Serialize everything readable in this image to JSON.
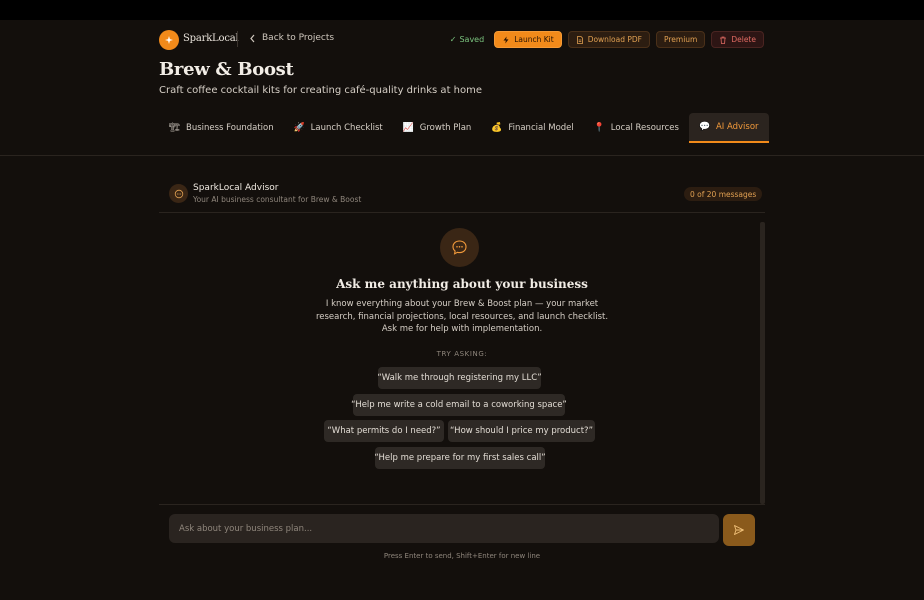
{
  "header": {
    "brand": "SparkLocal",
    "back_label": "Back to Projects",
    "saved_label": "Saved",
    "launch_kit_label": "Launch Kit",
    "download_pdf_label": "Download PDF",
    "premium_label": "Premium",
    "delete_label": "Delete"
  },
  "project": {
    "title": "Brew & Boost",
    "subtitle": "Craft coffee cocktail kits for creating café-quality drinks at home"
  },
  "tabs": [
    {
      "label": "Business Foundation",
      "icon": "🏗"
    },
    {
      "label": "Launch Checklist",
      "icon": "🚀"
    },
    {
      "label": "Growth Plan",
      "icon": "📈"
    },
    {
      "label": "Financial Model",
      "icon": "💰"
    },
    {
      "label": "Local Resources",
      "icon": "📍"
    },
    {
      "label": "AI Advisor",
      "icon": "💬"
    }
  ],
  "advisor": {
    "name": "SparkLocal Advisor",
    "subtitle": "Your AI business consultant for Brew & Boost",
    "message_count": "0 of 20 messages"
  },
  "empty_state": {
    "title": "Ask me anything about your business",
    "description": "I know everything about your Brew & Boost plan — your market research, financial projections, local resources, and launch checklist. Ask me for help with implementation.",
    "try_label": "TRY ASKING:"
  },
  "suggestions": [
    "“Walk me through registering my LLC”",
    "“Help me write a cold email to a coworking space”",
    "“What permits do I need?”",
    "“How should I price my product?”",
    "“Help me prepare for my first sales call”"
  ],
  "composer": {
    "placeholder": "Ask about your business plan...",
    "hint": "Press Enter to send, Shift+Enter for new line"
  },
  "colors": {
    "accent": "#f28a1a",
    "background": "#130f0c",
    "saved": "#7bc47f",
    "danger": "#e06a62"
  }
}
